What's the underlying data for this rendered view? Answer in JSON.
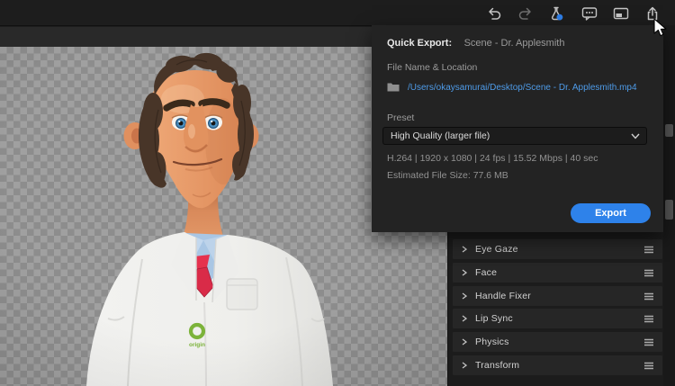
{
  "toolbar": {
    "icons": [
      "undo",
      "redo",
      "experimental-features",
      "comments",
      "panel-layout",
      "share-export"
    ]
  },
  "quick_export": {
    "title": "Quick Export:",
    "scene_name": "Scene - Dr. Applesmith",
    "file_label": "File Name & Location",
    "file_path": "/Users/okaysamurai/Desktop/Scene - Dr. Applesmith.mp4",
    "preset_label": "Preset",
    "preset_value": "High Quality (larger file)",
    "specs": "H.264 | 1920 x 1080 | 24 fps | 15.52 Mbps | 40 sec",
    "estimated_size": "Estimated File Size: 77.6 MB",
    "export_label": "Export"
  },
  "properties": {
    "rows": [
      {
        "label": "Eye Gaze"
      },
      {
        "label": "Face"
      },
      {
        "label": "Handle Fixer"
      },
      {
        "label": "Lip Sync"
      },
      {
        "label": "Physics"
      },
      {
        "label": "Transform"
      }
    ]
  },
  "scene": {
    "character": "Dr. Applesmith puppet on transparent checkerboard",
    "badge_text": "origin"
  },
  "colors": {
    "accent_blue": "#2e82ea",
    "link_blue": "#4e9be8",
    "panel_bg": "#232323",
    "checker_light": "#a0a0a0",
    "checker_dark": "#8d8d8d",
    "tie_red": "#e5314e",
    "badge_green": "#7cb33a"
  }
}
